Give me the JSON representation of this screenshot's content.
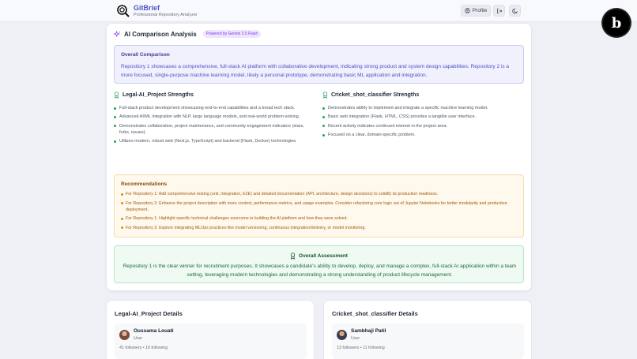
{
  "app": {
    "title": "GitBrief",
    "subtitle": "Professional Repository Analyzer",
    "profile_label": "Profile"
  },
  "comparison": {
    "heading": "AI Comparison Analysis",
    "badge": "Powered by Gemini 2.5 Flash",
    "overall": {
      "title": "Overall Comparison",
      "text": "Repository 1 showcases a comprehensive, full-stack AI platform with collaborative development, indicating strong product and system design capabilities. Repository 2 is a more focused, single-purpose machine learning model, likely a personal prototype, demonstrating basic ML application and integration."
    },
    "repo1_strengths": {
      "title": "Legal-AI_Project Strengths",
      "items": [
        "Full-stack product development showcasing end-to-end capabilities and a broad tech stack.",
        "Advanced AI/ML integration with NLP, large language models, and real-world problem-solving.",
        "Demonstrates collaboration, project maintenance, and community engagement indicators (stars, forks, issues).",
        "Utilizes modern, robust web (Next.js, TypeScript) and backend (Flask, Docker) technologies."
      ]
    },
    "repo2_strengths": {
      "title": "Cricket_shot_classifier Strengths",
      "items": [
        "Demonstrates ability to implement and integrate a specific machine learning model.",
        "Basic web integration (Flask, HTML, CSS) provides a tangible user interface.",
        "Recent activity indicates continued interest in the project area.",
        "Focused on a clear, domain-specific problem."
      ]
    },
    "recommendations": {
      "title": "Recommendations",
      "items": [
        "For Repository 1: Add comprehensive testing (unit, integration, E2E) and detailed documentation (API, architecture, design decisions) to solidify its production readiness.",
        "For Repository 2: Enhance the project description with more context, performance metrics, and usage examples. Consider refactoring core logic out of Jupyter Notebooks for better modularity and production deployment.",
        "For Repository 1: Highlight specific technical challenges overcome in building the AI platform and how they were solved.",
        "For Repository 2: Explore integrating MLOps practices like model versioning, continuous integration/delivery, or model monitoring."
      ]
    },
    "assessment": {
      "title": "Overall Assessment",
      "text": "Repository 1 is the clear winner for recruitment purposes. It showcases a candidate's ability to develop, deploy, and manage a complex, full-stack AI application within a team setting, leveraging modern technologies and demonstrating a strong understanding of product lifecycle management."
    }
  },
  "details": [
    {
      "title": "Legal-AI_Project Details",
      "user_name": "Oussama Louati",
      "user_role": "User",
      "follow_text": "41 followers • 16 following"
    },
    {
      "title": "Cricket_shot_classifier Details",
      "user_name": "Sambhaji Patil",
      "user_role": "User",
      "follow_text": "13 followers • 11 following"
    }
  ],
  "colors": {
    "brand": "#4a53c8",
    "accent_purple": "#7c3aed",
    "success": "#22a35a",
    "warning": "#e08a12"
  },
  "icons": [
    "magnifier-logo-icon",
    "user-icon",
    "logout-icon",
    "moon-icon",
    "sparkles-icon",
    "award-icon",
    "bolt-badge-icon"
  ]
}
